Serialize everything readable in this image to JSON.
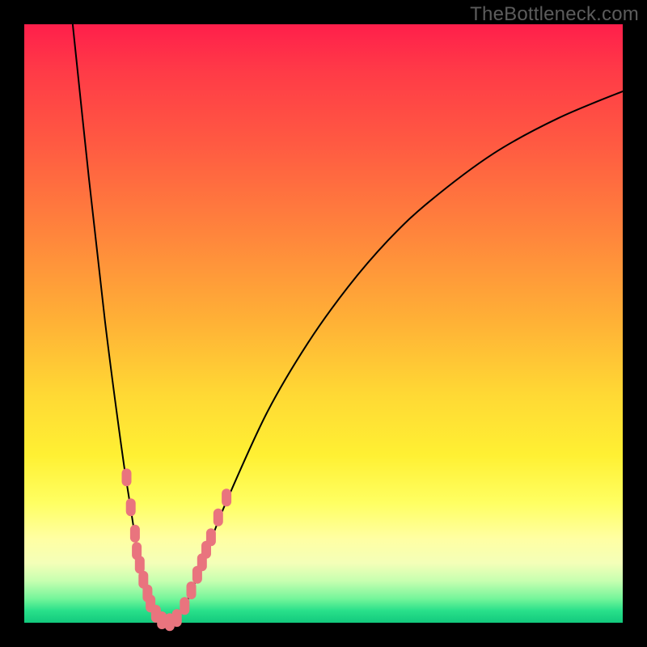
{
  "watermark": "TheBottleneck.com",
  "colors": {
    "frame": "#000000",
    "gradient_top": "#ff1f4b",
    "gradient_mid": "#ffd934",
    "gradient_bottom": "#12c97d",
    "curve": "#000000",
    "marker": "#e9747e"
  },
  "chart_data": {
    "type": "line",
    "title": "",
    "xlabel": "",
    "ylabel": "",
    "xlim": [
      0,
      100
    ],
    "ylim": [
      0,
      100
    ],
    "grid": false,
    "legend": false,
    "note": "V-shaped bottleneck curve. y-axis is inverted visually (0 at bottom, 100 at top). Values estimated from pixel positions; no axis ticks are rendered.",
    "series": [
      {
        "name": "curve-left",
        "x": [
          8.1,
          10.8,
          13.5,
          16.2,
          17.6,
          18.9,
          20.3,
          21.6,
          23.0
        ],
        "y": [
          100.0,
          74.3,
          50.3,
          29.6,
          20.3,
          12.2,
          6.1,
          2.0,
          0.0
        ]
      },
      {
        "name": "curve-right",
        "x": [
          25.3,
          27.0,
          29.1,
          31.1,
          33.8,
          40.5,
          47.3,
          54.1,
          60.8,
          67.6,
          78.4,
          89.2,
          100.0
        ],
        "y": [
          0.5,
          3.2,
          8.1,
          13.5,
          20.3,
          35.0,
          46.6,
          56.1,
          63.9,
          70.3,
          78.4,
          84.3,
          88.8
        ]
      }
    ],
    "markers": {
      "name": "highlight-points",
      "note": "Pink lozenge markers clustered near the curve's minimum on both branches.",
      "points": [
        {
          "x": 17.1,
          "y": 24.3
        },
        {
          "x": 17.8,
          "y": 19.3
        },
        {
          "x": 18.5,
          "y": 14.9
        },
        {
          "x": 18.8,
          "y": 12.0
        },
        {
          "x": 19.3,
          "y": 9.7
        },
        {
          "x": 19.9,
          "y": 7.2
        },
        {
          "x": 20.6,
          "y": 4.9
        },
        {
          "x": 21.1,
          "y": 3.2
        },
        {
          "x": 22.0,
          "y": 1.5
        },
        {
          "x": 23.0,
          "y": 0.4
        },
        {
          "x": 24.3,
          "y": 0.1
        },
        {
          "x": 25.5,
          "y": 0.8
        },
        {
          "x": 26.8,
          "y": 2.8
        },
        {
          "x": 27.9,
          "y": 5.4
        },
        {
          "x": 28.9,
          "y": 8.0
        },
        {
          "x": 29.7,
          "y": 10.1
        },
        {
          "x": 30.4,
          "y": 12.2
        },
        {
          "x": 31.2,
          "y": 14.3
        },
        {
          "x": 32.4,
          "y": 17.6
        },
        {
          "x": 33.8,
          "y": 20.9
        }
      ]
    }
  }
}
